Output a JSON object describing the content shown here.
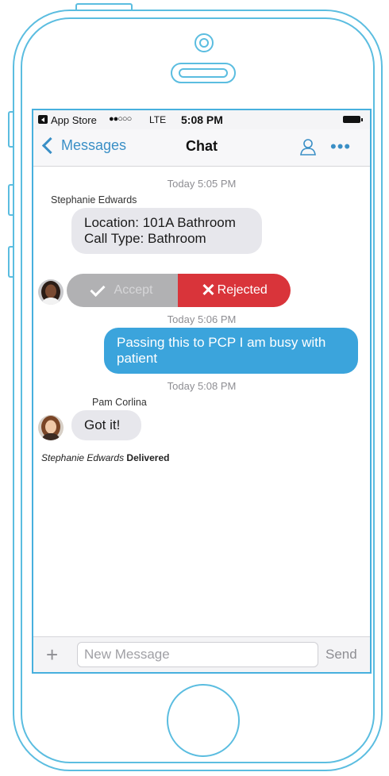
{
  "status_bar": {
    "carrier": "App Store",
    "signal": "●●○○○",
    "network": "LTE",
    "time": "5:08 PM"
  },
  "nav": {
    "back_label": "Messages",
    "title": "Chat"
  },
  "messages": {
    "stamp_1": "Today 5:05 PM",
    "sender_1": "Stephanie Edwards",
    "bubble_1_line_1": "Location: 101A Bathroom",
    "bubble_1_line_2": "Call Type: Bathroom",
    "accept_label": "Accept",
    "reject_label": "Rejected",
    "stamp_2": "Today 5:06 PM",
    "bubble_2": "Passing this to PCP I am busy with patient",
    "stamp_3": "Today 5:08 PM",
    "sender_3": "Pam Corlina",
    "bubble_3": "Got it!",
    "delivered_who": "Stephanie Edwards",
    "delivered_state": "Delivered"
  },
  "composer": {
    "placeholder": "New Message",
    "send_label": "Send"
  },
  "colors": {
    "accent": "#3a8fc6",
    "outgoing_bubble": "#3ba4dc",
    "reject": "#d9343a",
    "accept_disabled": "#b1b1b3",
    "device_outline": "#5bbde0"
  }
}
